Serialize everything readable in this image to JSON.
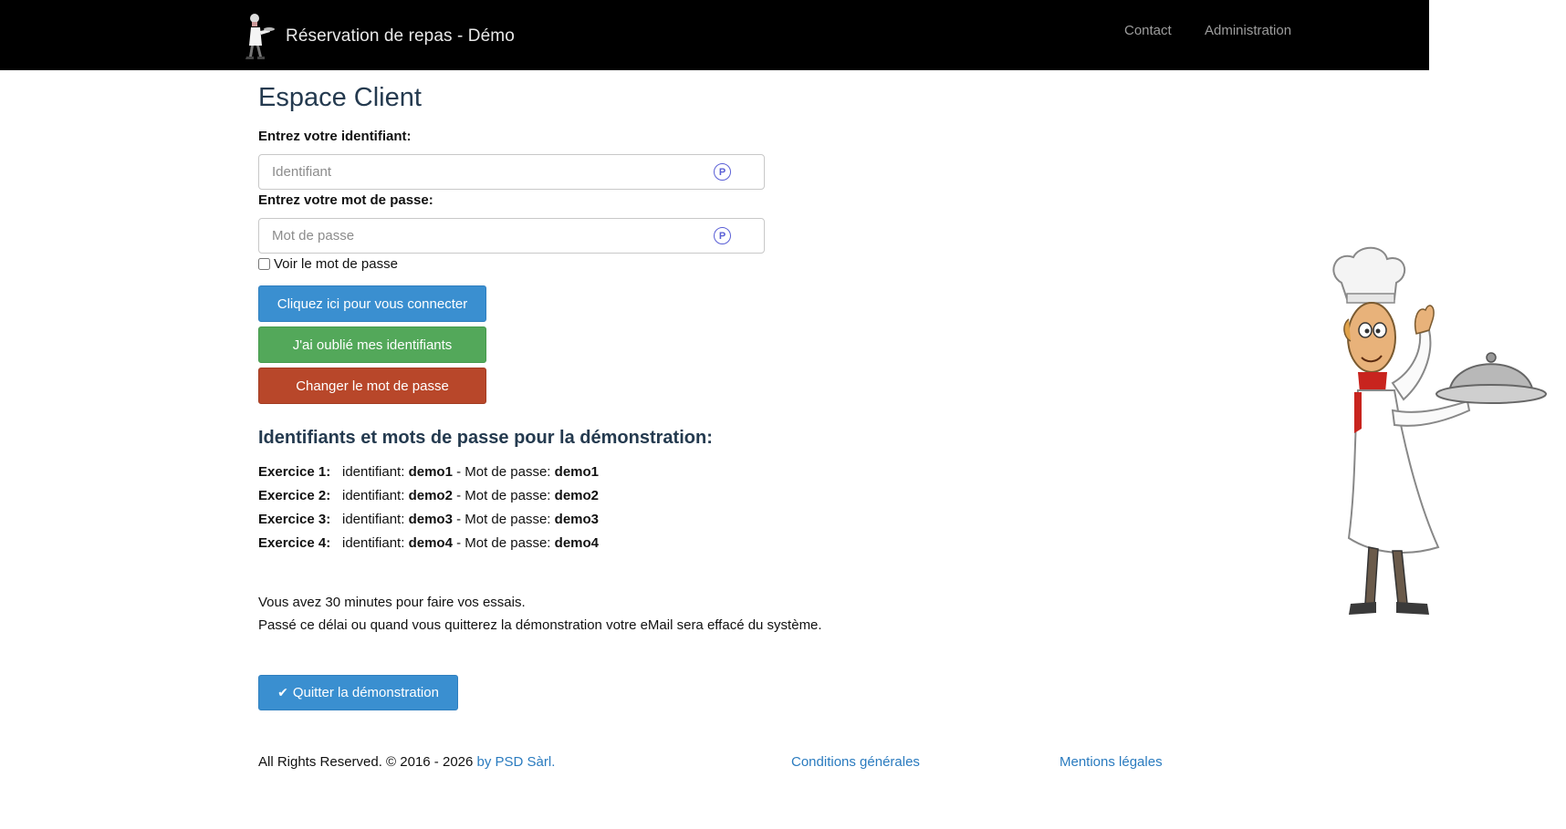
{
  "navbar": {
    "title": "Réservation de repas - Démo",
    "links": [
      "Contact",
      "Administration"
    ]
  },
  "login": {
    "page_title": "Espace Client",
    "username_label": "Entrez votre identifiant:",
    "username_placeholder": "Identifiant",
    "password_label": "Entrez votre mot de passe:",
    "password_placeholder": "Mot de passe",
    "show_password_label": "Voir le mot de passe",
    "login_button": "Cliquez ici pour vous connecter",
    "forgot_button": "J'ai oublié mes identifiants",
    "change_button": "Changer le mot de passe"
  },
  "demo": {
    "heading": "Identifiants et mots de passe pour la démonstration:",
    "id_label": "identifiant:",
    "pw_label": " - Mot de passe:",
    "rows": [
      {
        "exercise": "Exercice 1:",
        "id": "demo1",
        "pw": "demo1"
      },
      {
        "exercise": "Exercice 2:",
        "id": "demo2",
        "pw": "demo2"
      },
      {
        "exercise": "Exercice 3:",
        "id": "demo3",
        "pw": "demo3"
      },
      {
        "exercise": "Exercice 4:",
        "id": "demo4",
        "pw": "demo4"
      }
    ],
    "note_1": "Vous avez 30 minutes pour faire vos essais.",
    "note_2": "Passé ce délai ou quand vous quitterez la démonstration votre eMail sera effacé du système.",
    "quit_button": "Quitter la démonstration"
  },
  "footer": {
    "rights": "All Rights Reserved. © 2016 - 2026 ",
    "company_link": "by PSD Sàrl.",
    "conditions_link": "Conditions générales",
    "legal_link": "Mentions légales"
  },
  "icons": {
    "password_manager": "p-circle-icon",
    "quit": "checkmark-icon"
  },
  "colors": {
    "navbar": "#000000",
    "primary_button": "#3a8fd0",
    "success_button": "#53a85a",
    "danger_button": "#b8472a",
    "heading": "#243a4f",
    "link": "#2a7bbf"
  }
}
